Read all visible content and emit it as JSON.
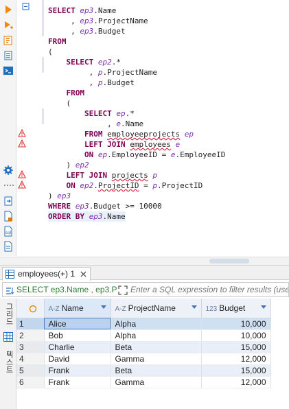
{
  "sql_lines": [
    "SELECT ep3.Name",
    "     , ep3.ProjectName",
    "     , ep3.Budget",
    "FROM",
    "(",
    "    SELECT ep2.*",
    "         , p.ProjectName",
    "         , p.Budget",
    "    FROM",
    "    (",
    "        SELECT ep.*",
    "             , e.Name",
    "        FROM employeeprojects ep",
    "        LEFT JOIN employees e",
    "        ON ep.EmployeeID = e.EmployeeID",
    "    ) ep2",
    "    LEFT JOIN projects p",
    "    ON ep2.ProjectID = p.ProjectID",
    ") ep3",
    "WHERE ep3.Budget >= 10000",
    "ORDER BY ep3.Name"
  ],
  "results": {
    "tab_label": "employees(+) 1",
    "filter_query": "SELECT ep3.Name , ep3.P",
    "filter_placeholder": "Enter a SQL expression to filter results (use",
    "side_tabs": [
      "그리드",
      "텍스트"
    ],
    "columns": [
      {
        "name": "Name",
        "type": "A-Z"
      },
      {
        "name": "ProjectName",
        "type": "A-Z"
      },
      {
        "name": "Budget",
        "type": "123"
      }
    ],
    "rows": [
      {
        "num": "1",
        "name": "Alice",
        "project": "Alpha",
        "budget": "10,000"
      },
      {
        "num": "2",
        "name": "Bob",
        "project": "Alpha",
        "budget": "10,000"
      },
      {
        "num": "3",
        "name": "Charlie",
        "project": "Beta",
        "budget": "15,000"
      },
      {
        "num": "4",
        "name": "David",
        "project": "Gamma",
        "budget": "12,000"
      },
      {
        "num": "5",
        "name": "Frank",
        "project": "Beta",
        "budget": "15,000"
      },
      {
        "num": "6",
        "name": "Frank",
        "project": "Gamma",
        "budget": "12,000"
      }
    ]
  },
  "colors": {
    "keyword": "#7f0055",
    "alias": "#7b2fb0",
    "selection": "#cfe0f3",
    "accent": "#1f6fbf",
    "warning": "#d22"
  },
  "icons": [
    "run-icon",
    "run-script-icon",
    "explain-icon",
    "load-icon",
    "console-icon",
    "settings-icon",
    "export-icon",
    "file-icon",
    "sql-icon",
    "save-icon",
    "warning-icon"
  ]
}
